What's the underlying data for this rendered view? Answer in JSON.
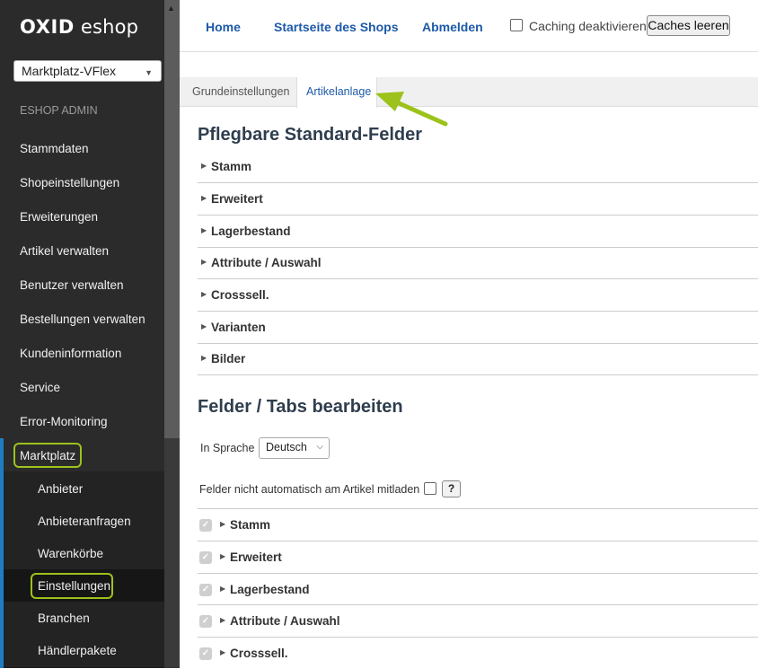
{
  "sidebar": {
    "logo": {
      "brand": "OXID",
      "product": "eshop"
    },
    "shop_select": "Marktplatz-VFlex",
    "admin_title": "ESHOP ADMIN",
    "menu": [
      "Stammdaten",
      "Shopeinstellungen",
      "Erweiterungen",
      "Artikel verwalten",
      "Benutzer verwalten",
      "Bestellungen verwalten",
      "Kundeninformation",
      "Service",
      "Error-Monitoring"
    ],
    "active_menu": "Marktplatz",
    "submenu": [
      "Anbieter",
      "Anbieteranfragen",
      "Warenkörbe",
      "Einstellungen",
      "Branchen",
      "Händlerpakete"
    ],
    "active_submenu": "Einstellungen"
  },
  "topbar": {
    "home": "Home",
    "shop_start": "Startseite des Shops",
    "logout": "Abmelden",
    "cache_label": "Caching deaktivieren",
    "cache_button": "Caches leeren"
  },
  "tabs": {
    "tab1": "Grundeinstellungen",
    "tab2": "Artikelanlage",
    "active": "Artikelanlage"
  },
  "section1": {
    "title": "Pflegbare Standard-Felder",
    "items": [
      "Stamm",
      "Erweitert",
      "Lagerbestand",
      "Attribute / Auswahl",
      "Crosssell.",
      "Varianten",
      "Bilder"
    ]
  },
  "section2": {
    "title": "Felder / Tabs bearbeiten",
    "language_label": "In Sprache",
    "language_value": "Deutsch",
    "noload_label": "Felder nicht automatisch am Artikel mitladen",
    "help": "?",
    "items": [
      "Stamm",
      "Erweitert",
      "Lagerbestand",
      "Attribute / Auswahl",
      "Crosssell."
    ]
  },
  "colors": {
    "sidebar_bg": "#2b2b2b",
    "link": "#1d5aa8",
    "highlight": "#9cc21b",
    "active_strip": "#1f7dc2"
  }
}
